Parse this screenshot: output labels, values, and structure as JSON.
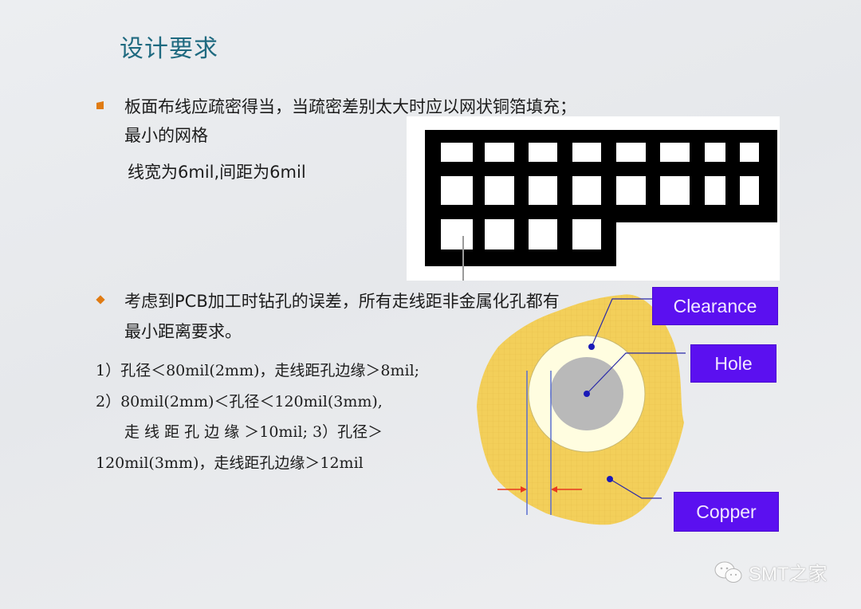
{
  "slide": {
    "title": "设计要求",
    "colors": {
      "title": "#1f6a80",
      "bullet": "#e07b13",
      "label_bg": "#5b10f0",
      "copper": "#f3cf5a",
      "clearance": "#fffde0",
      "hole": "#b9b9b9",
      "pointer": "#2a2aa8",
      "dimension_arrow": "#e8391e"
    }
  },
  "section1": {
    "bullet_icon": "square-bullet-icon",
    "line1": "板面布线应疏密得当，当疏密差别太大时应以网状铜箔填充；",
    "line2": "最小的网格",
    "line3": "线宽为6mil,间距为6mil"
  },
  "mesh_diagram": {
    "description": "mesh copper grid example",
    "rows": [
      {
        "cells": 8
      },
      {
        "cells": 8
      },
      {
        "cells": 4
      }
    ]
  },
  "section2": {
    "bullet_icon": "diamond-bullet-icon",
    "line1": "考虑到PCB加工时钻孔的误差，所有走线距非金属化孔都有",
    "line2": "最小距离要求。",
    "rules": [
      "1）孔径＜80mil(2mm)，走线距孔边缘＞8mil;",
      "2）80mil(2mm)＜孔径＜120mil(3mm),",
      "走 线 距 孔 边 缘 ＞10mil;   3）孔径＞",
      "120mil(3mm)，走线距孔边缘＞12mil"
    ]
  },
  "clearance_diagram": {
    "labels": {
      "clearance": "Clearance",
      "hole": "Hole",
      "copper": "Copper"
    }
  },
  "watermark": {
    "icon": "wechat-icon",
    "text": "SMT之家"
  }
}
